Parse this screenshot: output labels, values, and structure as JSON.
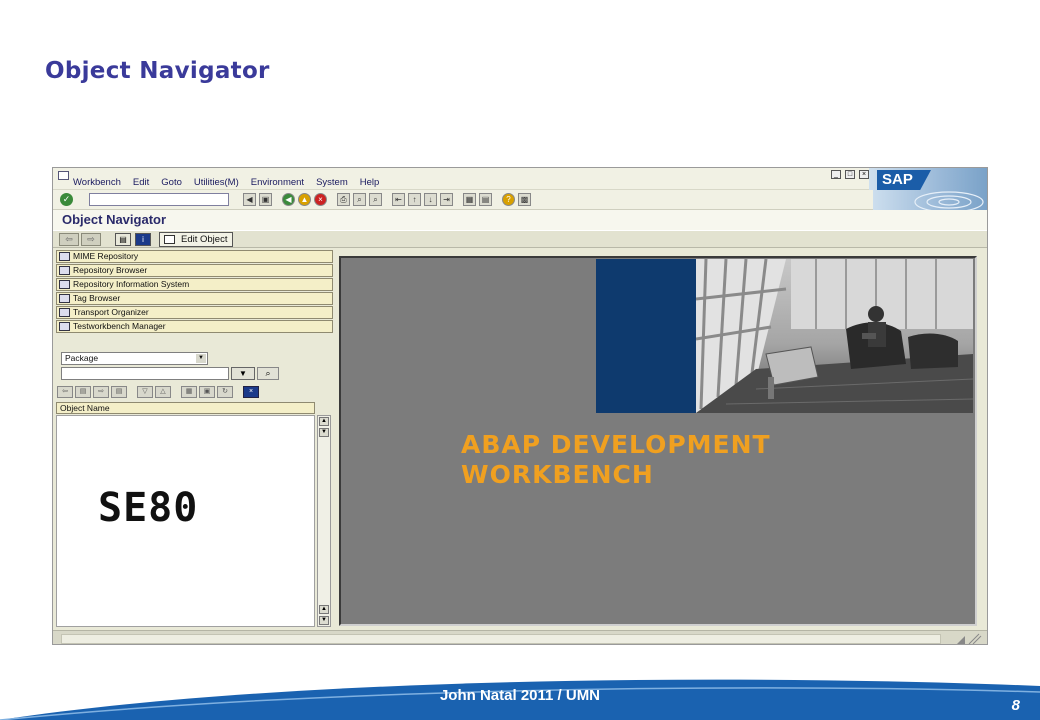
{
  "slide": {
    "title": "Object Navigator",
    "callout": "SE80",
    "footer": "John Natal 2011 / UMN",
    "page_number": "8"
  },
  "sap_window": {
    "menu": [
      "Workbench",
      "Edit",
      "Goto",
      "Utilities(M)",
      "Environment",
      "System",
      "Help"
    ],
    "logo_text": "SAP",
    "screen_title": "Object Navigator",
    "app_toolbar": {
      "edit_object_label": "Edit Object"
    },
    "nav_buttons": [
      "MIME Repository",
      "Repository Browser",
      "Repository Information System",
      "Tag Browser",
      "Transport Organizer",
      "Testworkbench Manager"
    ],
    "object_type_select": "Package",
    "object_name_input": "",
    "tree_header": "Object Name",
    "splash_title_line1": "ABAP DEVELOPMENT",
    "splash_title_line2": "WORKBENCH"
  },
  "colors": {
    "title_blue": "#3a3a9a",
    "footer_blue": "#1a62b0",
    "splash_orange": "#f0a020",
    "splash_navy": "#0e3a6e"
  }
}
